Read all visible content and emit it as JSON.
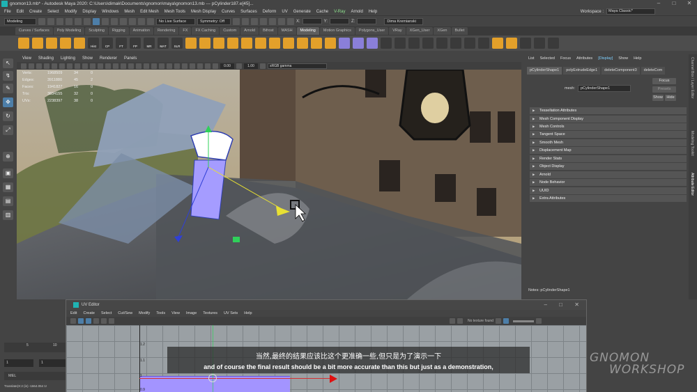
{
  "window": {
    "title": "gnomon13.mb* - Autodesk Maya 2020: C:\\Users\\dimak\\Documents\\gnomon\\maya\\gnomon13.mb  ---  pCylinder187.e[45]...",
    "min": "–",
    "max": "□",
    "close": "✕"
  },
  "menubar": {
    "items": [
      "File",
      "Edit",
      "Create",
      "Select",
      "Modify",
      "Display",
      "Windows",
      "Mesh",
      "Edit Mesh",
      "Mesh Tools",
      "Mesh Display",
      "Curves",
      "Surfaces",
      "Deform",
      "UV",
      "Generate",
      "Cache",
      "V-Ray",
      "Arnold",
      "Help"
    ],
    "workspace_label": "Workspace :",
    "workspace_value": "Maya Classic*"
  },
  "statusline": {
    "mode": "Modeling",
    "live_surface": "No Live Surface",
    "symmetry": "Symmetry: Off",
    "x_label": "X:",
    "y_label": "Y:",
    "z_label": "Z:",
    "user": "Dima Kremianski"
  },
  "shelf": {
    "tabs": [
      "Curves / Surfaces",
      "Poly Modeling",
      "Sculpting",
      "Rigging",
      "Animation",
      "Rendering",
      "FX",
      "FX Caching",
      "Custom",
      "Arnold",
      "Bifrost",
      "MASH",
      "Modeling",
      "Motion Graphics",
      "Polygons_User",
      "VRay",
      "XGen_User",
      "XGen",
      "Bullet"
    ],
    "active_tab": "Modeling",
    "icon_labels": [
      "Hist",
      "CP",
      "FT",
      "FP",
      "MR",
      "MAT",
      "SLR"
    ]
  },
  "viewport": {
    "menu": [
      "View",
      "Shading",
      "Lighting",
      "Show",
      "Renderer",
      "Panels"
    ],
    "exposure": "0.00",
    "gamma": "1.00",
    "colorspace": "sRGB gamma",
    "hud": [
      {
        "label": "Verts:",
        "value": "1968509",
        "sel": "34",
        "comp": "0"
      },
      {
        "label": "Edges:",
        "value": "3911880",
        "sel": "45",
        "comp": "2"
      },
      {
        "label": "Faces:",
        "value": "1941827",
        "sel": "16",
        "comp": "0"
      },
      {
        "label": "Tris:",
        "value": "3834155",
        "sel": "32",
        "comp": "0"
      },
      {
        "label": "UVs:",
        "value": "2238397",
        "sel": "38",
        "comp": "0"
      }
    ]
  },
  "attribute_editor": {
    "menu": [
      "List",
      "Selected",
      "Focus",
      "Attributes",
      "Display",
      "Show",
      "Help"
    ],
    "active_menu": "Display",
    "tabs": [
      "pCylinderShape1",
      "polyExtrudeEdge1",
      "deleteComponent3",
      "deleteCom"
    ],
    "mesh_label": "mesh:",
    "mesh_value": "pCylinderShape1",
    "focus": "Focus",
    "presets": "Presets",
    "show": "Show",
    "hide": "Hide",
    "sections": [
      "Tessellation Attributes",
      "Mesh Component Display",
      "Mesh Controls",
      "Tangent Space",
      "Smooth Mesh",
      "Displacement Map",
      "Render Stats",
      "Object Display",
      "Arnold",
      "Node Behavior",
      "UUID",
      "Extra Attributes"
    ],
    "notes": "Notes:  pCylinderShape1",
    "side_tabs": [
      "Channel Box / Layer Editor",
      "Modeling Toolkit",
      "Attribute Editor"
    ]
  },
  "timeline": {
    "ticks": [
      "5",
      "10"
    ],
    "start": "1",
    "current": "1",
    "mel": "MEL",
    "readout": "Translate(X:2 (in)    -1664.054    1!"
  },
  "uv_editor": {
    "title": "UV Editor",
    "menu": [
      "Edit",
      "Create",
      "Select",
      "Cut/Sew",
      "Modify",
      "Tools",
      "View",
      "Image",
      "Textures",
      "UV Sets",
      "Help"
    ],
    "no_texture": "No texture found",
    "axis_labels": [
      "1.2",
      "1.1",
      "1",
      "0.9"
    ]
  },
  "subtitle": {
    "zh": "当然,最终的结果应该比这个更准确一些,但只是为了演示一下",
    "en": "and of course the final result should be a bit more accurate than this but just as a demonstration,"
  },
  "watermark": {
    "line1": "GNOMON",
    "line2": "WORKSHOP"
  },
  "colors": {
    "accent": "#4d7ea8",
    "vray": "#8fe38f",
    "display_highlight": "#7fd0ff",
    "uv_shell": "#a394ff"
  }
}
